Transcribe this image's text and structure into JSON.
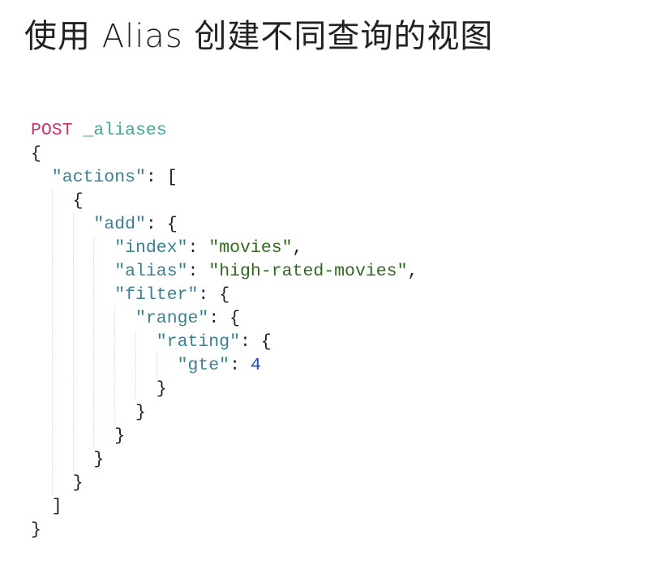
{
  "title": "使用 Alias 创建不同查询的视图",
  "code": {
    "lines": [
      {
        "indent": 0,
        "tokens": [
          {
            "t": "method",
            "v": "POST"
          },
          {
            "t": "p",
            "v": " "
          },
          {
            "t": "path",
            "v": "_aliases"
          }
        ]
      },
      {
        "indent": 0,
        "tokens": [
          {
            "t": "p",
            "v": "{"
          }
        ]
      },
      {
        "indent": 1,
        "tokens": [
          {
            "t": "key",
            "v": "\"actions\""
          },
          {
            "t": "p",
            "v": ": ["
          }
        ]
      },
      {
        "indent": 2,
        "tokens": [
          {
            "t": "p",
            "v": "{"
          }
        ]
      },
      {
        "indent": 3,
        "tokens": [
          {
            "t": "key",
            "v": "\"add\""
          },
          {
            "t": "p",
            "v": ": {"
          }
        ]
      },
      {
        "indent": 4,
        "tokens": [
          {
            "t": "key",
            "v": "\"index\""
          },
          {
            "t": "p",
            "v": ": "
          },
          {
            "t": "str",
            "v": "\"movies\""
          },
          {
            "t": "p",
            "v": ","
          }
        ]
      },
      {
        "indent": 4,
        "tokens": [
          {
            "t": "key",
            "v": "\"alias\""
          },
          {
            "t": "p",
            "v": ": "
          },
          {
            "t": "str",
            "v": "\"high-rated-movies\""
          },
          {
            "t": "p",
            "v": ","
          }
        ]
      },
      {
        "indent": 4,
        "tokens": [
          {
            "t": "key",
            "v": "\"filter\""
          },
          {
            "t": "p",
            "v": ": {"
          }
        ]
      },
      {
        "indent": 5,
        "tokens": [
          {
            "t": "key",
            "v": "\"range\""
          },
          {
            "t": "p",
            "v": ": {"
          }
        ]
      },
      {
        "indent": 6,
        "tokens": [
          {
            "t": "key",
            "v": "\"rating\""
          },
          {
            "t": "p",
            "v": ": {"
          }
        ]
      },
      {
        "indent": 7,
        "tokens": [
          {
            "t": "key",
            "v": "\"gte\""
          },
          {
            "t": "p",
            "v": ": "
          },
          {
            "t": "num",
            "v": "4"
          }
        ]
      },
      {
        "indent": 6,
        "tokens": [
          {
            "t": "p",
            "v": "}"
          }
        ]
      },
      {
        "indent": 5,
        "tokens": [
          {
            "t": "p",
            "v": "}"
          }
        ]
      },
      {
        "indent": 4,
        "tokens": [
          {
            "t": "p",
            "v": "}"
          }
        ]
      },
      {
        "indent": 3,
        "tokens": [
          {
            "t": "p",
            "v": "}"
          }
        ]
      },
      {
        "indent": 2,
        "tokens": [
          {
            "t": "p",
            "v": "}"
          }
        ]
      },
      {
        "indent": 1,
        "tokens": [
          {
            "t": "p",
            "v": "]"
          }
        ]
      },
      {
        "indent": 0,
        "tokens": [
          {
            "t": "p",
            "v": "}"
          }
        ]
      }
    ]
  }
}
